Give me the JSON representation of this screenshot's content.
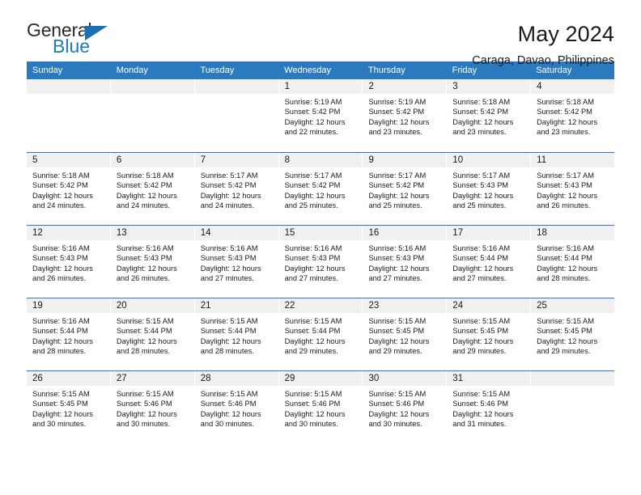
{
  "brand": {
    "name_top": "General",
    "name_bottom": "Blue",
    "accent_color": "#1b6fb5"
  },
  "header": {
    "title": "May 2024",
    "subtitle": "Caraga, Davao, Philippines"
  },
  "calendar": {
    "header_bg": "#2b7ac0",
    "daynum_bg": "#f0f0f0",
    "weekdays": [
      "Sunday",
      "Monday",
      "Tuesday",
      "Wednesday",
      "Thursday",
      "Friday",
      "Saturday"
    ],
    "weeks": [
      [
        {
          "day": "",
          "empty": true,
          "sunrise": "",
          "sunset": "",
          "daylight1": "",
          "daylight2": ""
        },
        {
          "day": "",
          "empty": true,
          "sunrise": "",
          "sunset": "",
          "daylight1": "",
          "daylight2": ""
        },
        {
          "day": "",
          "empty": true,
          "sunrise": "",
          "sunset": "",
          "daylight1": "",
          "daylight2": ""
        },
        {
          "day": "1",
          "empty": false,
          "sunrise": "Sunrise: 5:19 AM",
          "sunset": "Sunset: 5:42 PM",
          "daylight1": "Daylight: 12 hours",
          "daylight2": "and 22 minutes."
        },
        {
          "day": "2",
          "empty": false,
          "sunrise": "Sunrise: 5:19 AM",
          "sunset": "Sunset: 5:42 PM",
          "daylight1": "Daylight: 12 hours",
          "daylight2": "and 23 minutes."
        },
        {
          "day": "3",
          "empty": false,
          "sunrise": "Sunrise: 5:18 AM",
          "sunset": "Sunset: 5:42 PM",
          "daylight1": "Daylight: 12 hours",
          "daylight2": "and 23 minutes."
        },
        {
          "day": "4",
          "empty": false,
          "sunrise": "Sunrise: 5:18 AM",
          "sunset": "Sunset: 5:42 PM",
          "daylight1": "Daylight: 12 hours",
          "daylight2": "and 23 minutes."
        }
      ],
      [
        {
          "day": "5",
          "empty": false,
          "sunrise": "Sunrise: 5:18 AM",
          "sunset": "Sunset: 5:42 PM",
          "daylight1": "Daylight: 12 hours",
          "daylight2": "and 24 minutes."
        },
        {
          "day": "6",
          "empty": false,
          "sunrise": "Sunrise: 5:18 AM",
          "sunset": "Sunset: 5:42 PM",
          "daylight1": "Daylight: 12 hours",
          "daylight2": "and 24 minutes."
        },
        {
          "day": "7",
          "empty": false,
          "sunrise": "Sunrise: 5:17 AM",
          "sunset": "Sunset: 5:42 PM",
          "daylight1": "Daylight: 12 hours",
          "daylight2": "and 24 minutes."
        },
        {
          "day": "8",
          "empty": false,
          "sunrise": "Sunrise: 5:17 AM",
          "sunset": "Sunset: 5:42 PM",
          "daylight1": "Daylight: 12 hours",
          "daylight2": "and 25 minutes."
        },
        {
          "day": "9",
          "empty": false,
          "sunrise": "Sunrise: 5:17 AM",
          "sunset": "Sunset: 5:42 PM",
          "daylight1": "Daylight: 12 hours",
          "daylight2": "and 25 minutes."
        },
        {
          "day": "10",
          "empty": false,
          "sunrise": "Sunrise: 5:17 AM",
          "sunset": "Sunset: 5:43 PM",
          "daylight1": "Daylight: 12 hours",
          "daylight2": "and 25 minutes."
        },
        {
          "day": "11",
          "empty": false,
          "sunrise": "Sunrise: 5:17 AM",
          "sunset": "Sunset: 5:43 PM",
          "daylight1": "Daylight: 12 hours",
          "daylight2": "and 26 minutes."
        }
      ],
      [
        {
          "day": "12",
          "empty": false,
          "sunrise": "Sunrise: 5:16 AM",
          "sunset": "Sunset: 5:43 PM",
          "daylight1": "Daylight: 12 hours",
          "daylight2": "and 26 minutes."
        },
        {
          "day": "13",
          "empty": false,
          "sunrise": "Sunrise: 5:16 AM",
          "sunset": "Sunset: 5:43 PM",
          "daylight1": "Daylight: 12 hours",
          "daylight2": "and 26 minutes."
        },
        {
          "day": "14",
          "empty": false,
          "sunrise": "Sunrise: 5:16 AM",
          "sunset": "Sunset: 5:43 PM",
          "daylight1": "Daylight: 12 hours",
          "daylight2": "and 27 minutes."
        },
        {
          "day": "15",
          "empty": false,
          "sunrise": "Sunrise: 5:16 AM",
          "sunset": "Sunset: 5:43 PM",
          "daylight1": "Daylight: 12 hours",
          "daylight2": "and 27 minutes."
        },
        {
          "day": "16",
          "empty": false,
          "sunrise": "Sunrise: 5:16 AM",
          "sunset": "Sunset: 5:43 PM",
          "daylight1": "Daylight: 12 hours",
          "daylight2": "and 27 minutes."
        },
        {
          "day": "17",
          "empty": false,
          "sunrise": "Sunrise: 5:16 AM",
          "sunset": "Sunset: 5:44 PM",
          "daylight1": "Daylight: 12 hours",
          "daylight2": "and 27 minutes."
        },
        {
          "day": "18",
          "empty": false,
          "sunrise": "Sunrise: 5:16 AM",
          "sunset": "Sunset: 5:44 PM",
          "daylight1": "Daylight: 12 hours",
          "daylight2": "and 28 minutes."
        }
      ],
      [
        {
          "day": "19",
          "empty": false,
          "sunrise": "Sunrise: 5:16 AM",
          "sunset": "Sunset: 5:44 PM",
          "daylight1": "Daylight: 12 hours",
          "daylight2": "and 28 minutes."
        },
        {
          "day": "20",
          "empty": false,
          "sunrise": "Sunrise: 5:15 AM",
          "sunset": "Sunset: 5:44 PM",
          "daylight1": "Daylight: 12 hours",
          "daylight2": "and 28 minutes."
        },
        {
          "day": "21",
          "empty": false,
          "sunrise": "Sunrise: 5:15 AM",
          "sunset": "Sunset: 5:44 PM",
          "daylight1": "Daylight: 12 hours",
          "daylight2": "and 28 minutes."
        },
        {
          "day": "22",
          "empty": false,
          "sunrise": "Sunrise: 5:15 AM",
          "sunset": "Sunset: 5:44 PM",
          "daylight1": "Daylight: 12 hours",
          "daylight2": "and 29 minutes."
        },
        {
          "day": "23",
          "empty": false,
          "sunrise": "Sunrise: 5:15 AM",
          "sunset": "Sunset: 5:45 PM",
          "daylight1": "Daylight: 12 hours",
          "daylight2": "and 29 minutes."
        },
        {
          "day": "24",
          "empty": false,
          "sunrise": "Sunrise: 5:15 AM",
          "sunset": "Sunset: 5:45 PM",
          "daylight1": "Daylight: 12 hours",
          "daylight2": "and 29 minutes."
        },
        {
          "day": "25",
          "empty": false,
          "sunrise": "Sunrise: 5:15 AM",
          "sunset": "Sunset: 5:45 PM",
          "daylight1": "Daylight: 12 hours",
          "daylight2": "and 29 minutes."
        }
      ],
      [
        {
          "day": "26",
          "empty": false,
          "sunrise": "Sunrise: 5:15 AM",
          "sunset": "Sunset: 5:45 PM",
          "daylight1": "Daylight: 12 hours",
          "daylight2": "and 30 minutes."
        },
        {
          "day": "27",
          "empty": false,
          "sunrise": "Sunrise: 5:15 AM",
          "sunset": "Sunset: 5:46 PM",
          "daylight1": "Daylight: 12 hours",
          "daylight2": "and 30 minutes."
        },
        {
          "day": "28",
          "empty": false,
          "sunrise": "Sunrise: 5:15 AM",
          "sunset": "Sunset: 5:46 PM",
          "daylight1": "Daylight: 12 hours",
          "daylight2": "and 30 minutes."
        },
        {
          "day": "29",
          "empty": false,
          "sunrise": "Sunrise: 5:15 AM",
          "sunset": "Sunset: 5:46 PM",
          "daylight1": "Daylight: 12 hours",
          "daylight2": "and 30 minutes."
        },
        {
          "day": "30",
          "empty": false,
          "sunrise": "Sunrise: 5:15 AM",
          "sunset": "Sunset: 5:46 PM",
          "daylight1": "Daylight: 12 hours",
          "daylight2": "and 30 minutes."
        },
        {
          "day": "31",
          "empty": false,
          "sunrise": "Sunrise: 5:15 AM",
          "sunset": "Sunset: 5:46 PM",
          "daylight1": "Daylight: 12 hours",
          "daylight2": "and 31 minutes."
        },
        {
          "day": "",
          "empty": true,
          "sunrise": "",
          "sunset": "",
          "daylight1": "",
          "daylight2": ""
        }
      ]
    ]
  }
}
